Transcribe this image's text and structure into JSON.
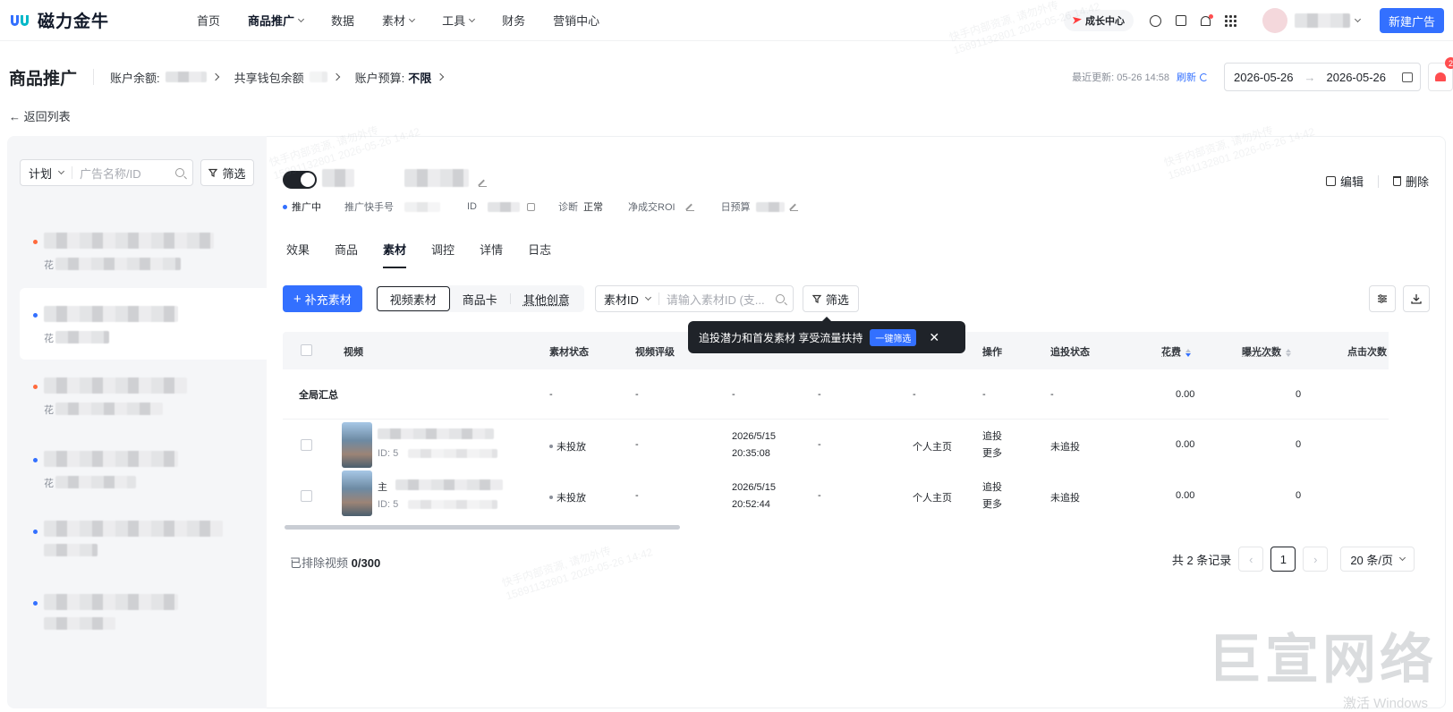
{
  "brand": {
    "name": "磁力金牛"
  },
  "nav": {
    "items": [
      {
        "label": "首页"
      },
      {
        "label": "商品推广",
        "active": true,
        "has_menu": true
      },
      {
        "label": "数据"
      },
      {
        "label": "素材",
        "has_menu": true
      },
      {
        "label": "工具",
        "has_menu": true
      },
      {
        "label": "财务"
      },
      {
        "label": "营销中心"
      }
    ],
    "growth_center": "成长中心",
    "new_ad_button": "新建广告"
  },
  "header": {
    "title": "商品推广",
    "account_balance_label": "账户余额:",
    "shared_wallet_label": "共享钱包余额",
    "budget_label": "账户预算:",
    "budget_value": "不限",
    "last_update": "最近更新: 05-26 14:58",
    "refresh_label": "刷新",
    "date_start": "2026-05-26",
    "date_end": "2026-05-26",
    "alarm_badge": "2"
  },
  "back_link": "← 返回列表",
  "left_panel": {
    "scope_select": "计划",
    "search_placeholder": "广告名称/ID",
    "filter_label": "筛选",
    "sub_label": "花"
  },
  "ad_detail": {
    "status": "推广中",
    "kuaishou_label": "推广快手号",
    "id_label": "ID",
    "diagnosis_label": "诊断",
    "diagnosis_value": "正常",
    "roi_label": "净成交ROI",
    "daily_budget_label": "日预算",
    "edit_label": "编辑",
    "delete_label": "删除"
  },
  "tabs": [
    {
      "label": "效果"
    },
    {
      "label": "商品"
    },
    {
      "label": "素材",
      "active": true
    },
    {
      "label": "调控"
    },
    {
      "label": "详情"
    },
    {
      "label": "日志"
    }
  ],
  "toolbar": {
    "add_material": "补充素材",
    "segments": [
      "视频素材",
      "商品卡",
      "其他创意"
    ],
    "id_select": "素材ID",
    "id_placeholder": "请输入素材ID (支...",
    "filter_label": "筛选"
  },
  "tooltip": {
    "text": "追投潜力和首发素材 享受流量扶持",
    "button": "一键筛选",
    "close": "✕"
  },
  "table": {
    "columns": [
      "视频",
      "素材状态",
      "视频评级",
      "操作",
      "追投状态",
      "花费",
      "曝光次数",
      "点击次数"
    ],
    "summary": {
      "label": "全局汇总",
      "dash": "-",
      "cost": "0.00",
      "impressions": "0"
    },
    "rows": [
      {
        "id_prefix": "ID: 5",
        "status": "未投放",
        "rating": "-",
        "date": "2026/5/15",
        "time": "20:35:08",
        "col5": "-",
        "home": "个人主页",
        "op1": "追投",
        "op2": "更多",
        "follow_status": "未追投",
        "cost": "0.00",
        "impressions": "0"
      },
      {
        "id_prefix": "ID: 5",
        "title_prefix": "主",
        "status": "未投放",
        "rating": "-",
        "date": "2026/5/15",
        "time": "20:52:44",
        "col5": "-",
        "home": "个人主页",
        "op1": "追投",
        "op2": "更多",
        "follow_status": "未追投",
        "cost": "0.00",
        "impressions": "0"
      }
    ]
  },
  "footer": {
    "excluded_label": "已排除视频",
    "excluded_value": "0/300",
    "total": "共 2 条记录",
    "current_page": "1",
    "page_size": "20 条/页"
  },
  "watermark": {
    "line1": "快手内部资源, 请勿外传",
    "line2": "15891132801 2026-05-26 14:42"
  },
  "overlay": {
    "brand": "巨宣网络",
    "windows": "激活 Windows"
  },
  "colors": {
    "primary": "#3370ff",
    "dark": "#1f2329",
    "alert": "#ff4d4f"
  }
}
